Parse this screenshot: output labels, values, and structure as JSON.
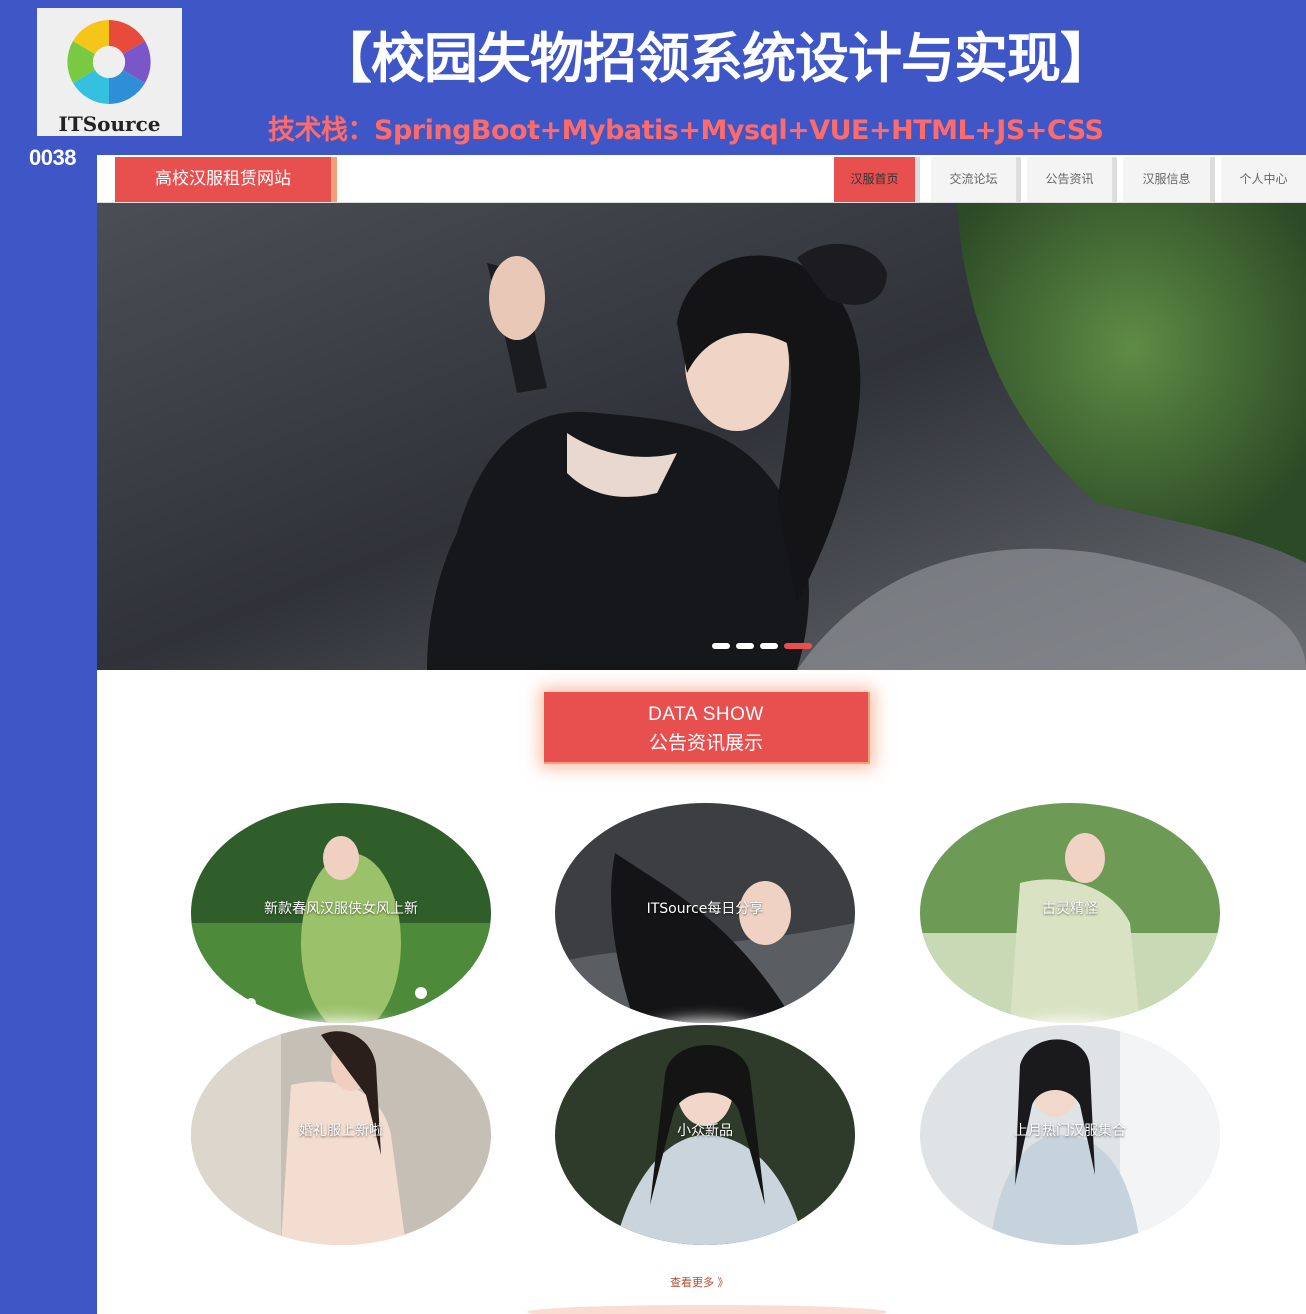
{
  "watermark": {
    "logo_text": "ITSource",
    "project_no": "0038",
    "title": "【校园失物招领系统设计与实现】",
    "tech_stack": "技术栈：SpringBoot+Mybatis+Mysql+VUE+HTML+JS+CSS"
  },
  "navbar": {
    "brand": "高校汉服租赁网站",
    "items": [
      {
        "label": "汉服首页",
        "active": true
      },
      {
        "label": "交流论坛",
        "active": false
      },
      {
        "label": "公告资讯",
        "active": false
      },
      {
        "label": "汉服信息",
        "active": false
      },
      {
        "label": "个人中心",
        "active": false
      }
    ]
  },
  "carousel": {
    "slide_count": 4,
    "active_index": 3
  },
  "section": {
    "title_en": "DATA SHOW",
    "title_cn": "公告资讯展示"
  },
  "news": [
    {
      "title": "新款春风汉服侠女风上新"
    },
    {
      "title": "ITSource每日分享"
    },
    {
      "title": "古灵精怪"
    },
    {
      "title": "婚礼服上新啦"
    },
    {
      "title": "小众新品"
    },
    {
      "title": "上月热门汉服集合"
    }
  ],
  "more_link": "查看更多 》",
  "colors": {
    "banner": "#3f56c7",
    "accent": "#e85050",
    "accent_border": "#f3a07a",
    "tech": "#ff6b6b"
  }
}
